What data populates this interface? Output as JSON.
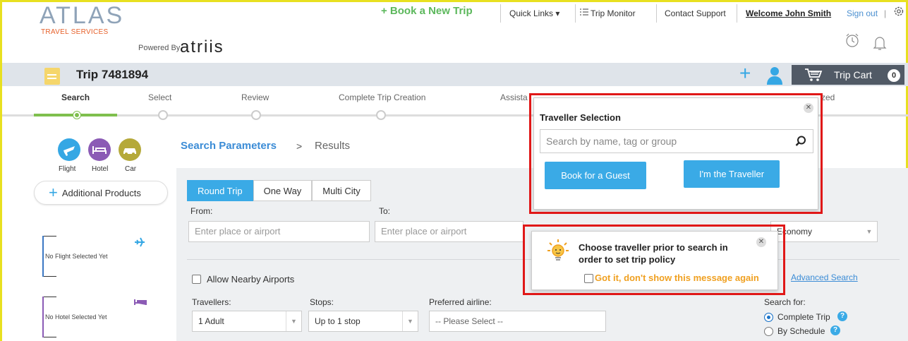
{
  "brand": {
    "name": "ATLAS",
    "sub": "TRAVEL SERVICES",
    "powered_by": "Powered By",
    "partner": "atriis"
  },
  "topnav": {
    "book_new": "+ Book a New Trip",
    "quick_links": "Quick Links ▾",
    "trip_monitor": "Trip Monitor",
    "contact_support": "Contact Support",
    "welcome": "Welcome John Smith",
    "sign_out": "Sign out",
    "pipe": "|"
  },
  "trip": {
    "title": "Trip 7481894",
    "cart_label": "Trip Cart",
    "cart_count": "0"
  },
  "steps": [
    "Search",
    "Select",
    "Review",
    "Complete Trip Creation",
    "Assista",
    "zed"
  ],
  "modes": [
    {
      "label": "Flight",
      "color": "#35a7e4"
    },
    {
      "label": "Hotel",
      "color": "#8b5bb5"
    },
    {
      "label": "Car",
      "color": "#b5a93a"
    }
  ],
  "additional_products": "Additional Products",
  "slots": {
    "flight": "No Flight Selected Yet",
    "hotel": "No Hotel Selected Yet"
  },
  "breadcrumb": {
    "current": "Search Parameters",
    "sep": ">",
    "next": "Results"
  },
  "trip_types": [
    "Round Trip",
    "One Way",
    "Multi City"
  ],
  "form": {
    "from_label": "From:",
    "to_label": "To:",
    "from_placeholder": "Enter place or airport",
    "to_placeholder": "Enter place or airport",
    "cabin": "Economy",
    "nearby": "Allow Nearby Airports",
    "advanced": "Advanced Search",
    "travellers_label": "Travellers:",
    "travellers_value": "1 Adult",
    "stops_label": "Stops:",
    "stops_value": "Up to 1 stop",
    "airline_label": "Preferred airline:",
    "airline_value": "-- Please Select --",
    "search_for": "Search for:",
    "opt_complete": "Complete Trip",
    "opt_schedule": "By Schedule"
  },
  "traveller_popup": {
    "title": "Traveller Selection",
    "search_placeholder": "Search by name, tag or group",
    "guest_btn": "Book for a Guest",
    "self_btn": "I'm the Traveller"
  },
  "tip_popup": {
    "message": "Choose traveller prior to search in order to set trip policy",
    "got_it": "Got it, don't show this message again"
  }
}
